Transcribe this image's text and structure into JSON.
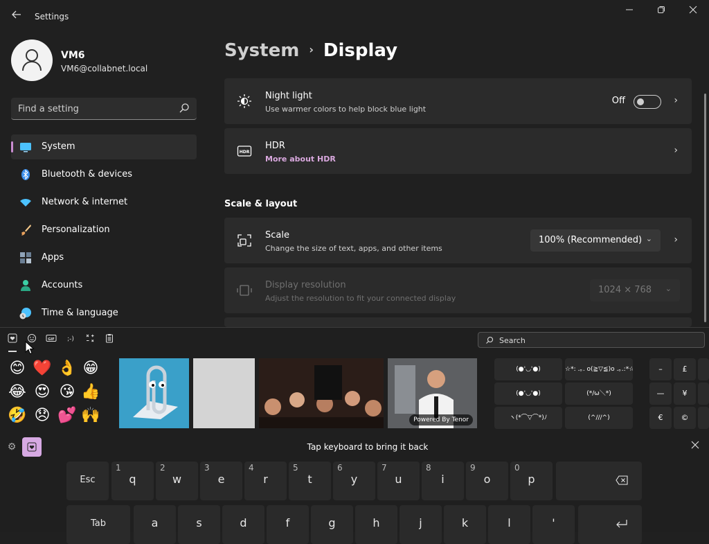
{
  "app": {
    "title": "Settings"
  },
  "user": {
    "name": "VM6",
    "email": "VM6@collabnet.local"
  },
  "search": {
    "placeholder": "Find a setting"
  },
  "nav": [
    {
      "label": "System",
      "active": true,
      "icon": "system-icon",
      "color": "#4cc2ff"
    },
    {
      "label": "Bluetooth & devices",
      "active": false,
      "icon": "bluetooth-icon",
      "color": "#3b8eea"
    },
    {
      "label": "Network & internet",
      "active": false,
      "icon": "wifi-icon",
      "color": "#4cc2ff"
    },
    {
      "label": "Personalization",
      "active": false,
      "icon": "paintbrush-icon",
      "color": "#e8a15c"
    },
    {
      "label": "Apps",
      "active": false,
      "icon": "apps-icon",
      "color": "#8fa3b8"
    },
    {
      "label": "Accounts",
      "active": false,
      "icon": "accounts-icon",
      "color": "#3ccfa5"
    },
    {
      "label": "Time & language",
      "active": false,
      "icon": "globe-clock-icon",
      "color": "#4cc2ff"
    }
  ],
  "breadcrumb": {
    "parent": "System",
    "current": "Display"
  },
  "cards": {
    "night_light": {
      "title": "Night light",
      "subtitle": "Use warmer colors to help block blue light",
      "state": "Off"
    },
    "hdr": {
      "title": "HDR",
      "subtitle": "More about HDR"
    },
    "scale": {
      "title": "Scale",
      "subtitle": "Change the size of text, apps, and other items",
      "value": "100% (Recommended)"
    },
    "resolution": {
      "title": "Display resolution",
      "subtitle": "Adjust the resolution to fit your connected display",
      "value": "1024 × 768"
    }
  },
  "section": {
    "scale_layout": "Scale & layout"
  },
  "panel": {
    "search_placeholder": "Search",
    "tabs": [
      "favorites",
      "emoji",
      "gif",
      "kaomoji",
      "symbols",
      "clipboard"
    ],
    "emoji": [
      "😊",
      "❤️",
      "👌",
      "😁",
      "😂",
      "😍",
      "😘",
      "👍",
      "🤣",
      "😞",
      "💕",
      "🙌"
    ],
    "gif_credit": "Powered By Tenor",
    "kaomoji": [
      "(●'◡'●)",
      "☆*: .｡. o(≧▽≦)o .｡.:*☆",
      "(●'◡'●)",
      "(*/ω＼*)",
      "ヽ(*⌒▽⌒*)ﾉ",
      "(^///^)"
    ],
    "symbols": [
      "–",
      "£",
      "—",
      "¥",
      "€",
      "©"
    ],
    "message": "Tap keyboard to bring it back"
  },
  "keyboard": {
    "row1": [
      {
        "label": "Esc",
        "num": ""
      },
      {
        "label": "q",
        "num": "1"
      },
      {
        "label": "w",
        "num": "2"
      },
      {
        "label": "e",
        "num": "3"
      },
      {
        "label": "r",
        "num": "4"
      },
      {
        "label": "t",
        "num": "5"
      },
      {
        "label": "y",
        "num": "6"
      },
      {
        "label": "u",
        "num": "7"
      },
      {
        "label": "i",
        "num": "8"
      },
      {
        "label": "o",
        "num": "9"
      },
      {
        "label": "p",
        "num": "0"
      }
    ],
    "row2": [
      {
        "label": "Tab"
      },
      {
        "label": "a"
      },
      {
        "label": "s"
      },
      {
        "label": "d"
      },
      {
        "label": "f"
      },
      {
        "label": "g"
      },
      {
        "label": "h"
      },
      {
        "label": "j"
      },
      {
        "label": "k"
      },
      {
        "label": "l"
      },
      {
        "label": "'"
      }
    ]
  }
}
